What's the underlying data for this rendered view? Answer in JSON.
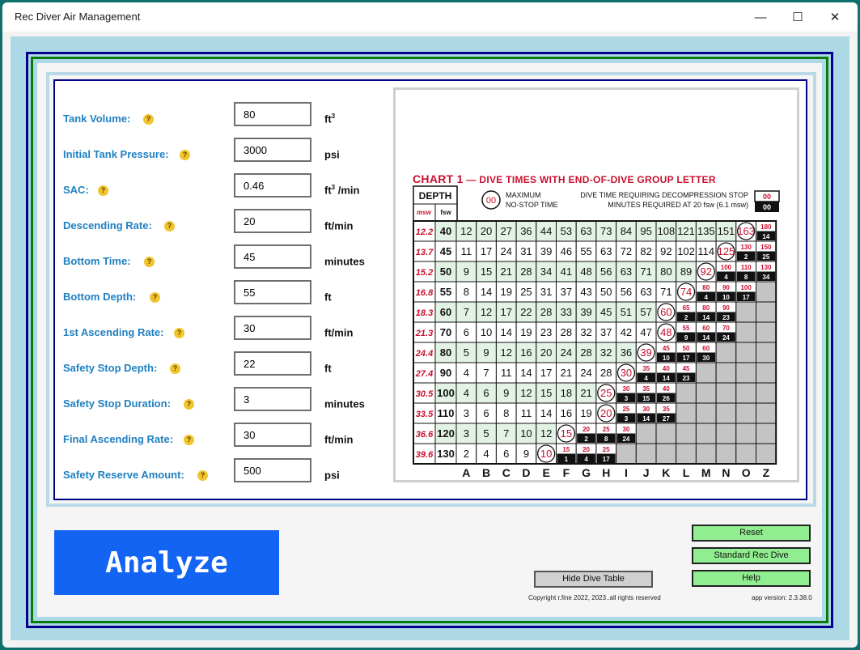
{
  "window": {
    "title": "Rec Diver Air Management",
    "minimize": "—",
    "maximize": "☐",
    "close": "✕"
  },
  "form": {
    "fields": [
      {
        "label": "Tank Volume:",
        "value": "80",
        "unit": "ft",
        "unit_sup": "3",
        "unit_suffix": ""
      },
      {
        "label": "Initial Tank Pressure:",
        "value": "3000",
        "unit": "psi",
        "unit_sup": "",
        "unit_suffix": ""
      },
      {
        "label": "SAC:",
        "value": "0.46",
        "unit": "ft",
        "unit_sup": "3",
        "unit_suffix": " /min"
      },
      {
        "label": "Descending Rate:",
        "value": "20",
        "unit": "ft/min",
        "unit_sup": "",
        "unit_suffix": ""
      },
      {
        "label": "Bottom Time:",
        "value": "45",
        "unit": "minutes",
        "unit_sup": "",
        "unit_suffix": ""
      },
      {
        "label": "Bottom Depth:",
        "value": "55",
        "unit": "ft",
        "unit_sup": "",
        "unit_suffix": ""
      },
      {
        "label": "1st Ascending Rate:",
        "value": "30",
        "unit": "ft/min",
        "unit_sup": "",
        "unit_suffix": ""
      },
      {
        "label": "Safety Stop Depth:",
        "value": "22",
        "unit": "ft",
        "unit_sup": "",
        "unit_suffix": ""
      },
      {
        "label": "Safety Stop Duration:",
        "value": "3",
        "unit": "minutes",
        "unit_sup": "",
        "unit_suffix": ""
      },
      {
        "label": "Final Ascending Rate:",
        "value": "30",
        "unit": "ft/min",
        "unit_sup": "",
        "unit_suffix": ""
      },
      {
        "label": "Safety Reserve Amount:",
        "value": "500",
        "unit": "psi",
        "unit_sup": "",
        "unit_suffix": ""
      }
    ],
    "help_glyph": "?"
  },
  "dive_table": {
    "title": "CHART 1",
    "title_sub": " — DIVE TIMES WITH END-OF-DIVE GROUP LETTER",
    "depth_header": "DEPTH",
    "msw_header": "msw",
    "fsw_header": "fsw",
    "legend_circle": "00",
    "legend_max_1": "MAXIMUM",
    "legend_max_2": "NO-STOP TIME",
    "legend_deco_1": "DIVE TIME REQUIRING DECOMPRESSION STOP",
    "legend_deco_2": "MINUTES REQUIRED AT 20 fsw (6.1 msw)",
    "legend_box_top": "00",
    "legend_box_bottom": "00",
    "colors": {
      "red": "#c8102e",
      "green_cell": "#e2f2e4",
      "gray_cell": "#c4c4c4",
      "black": "#111111"
    },
    "group_letters": [
      "A",
      "B",
      "C",
      "D",
      "E",
      "F",
      "G",
      "H",
      "I",
      "J",
      "K",
      "L",
      "M",
      "N",
      "O",
      "Z"
    ],
    "rows": [
      {
        "msw": "12.2",
        "fsw": "40",
        "times": [
          "12",
          "20",
          "27",
          "36",
          "44",
          "53",
          "63",
          "73",
          "84",
          "95",
          "108",
          "121",
          "135",
          "151"
        ],
        "max": "163",
        "deco": [
          [
            "180",
            "14"
          ]
        ]
      },
      {
        "msw": "13.7",
        "fsw": "45",
        "times": [
          "11",
          "17",
          "24",
          "31",
          "39",
          "46",
          "55",
          "63",
          "72",
          "82",
          "92",
          "102",
          "114"
        ],
        "max": "125",
        "deco": [
          [
            "130",
            "2"
          ],
          [
            "150",
            "25"
          ]
        ]
      },
      {
        "msw": "15.2",
        "fsw": "50",
        "times": [
          "9",
          "15",
          "21",
          "28",
          "34",
          "41",
          "48",
          "56",
          "63",
          "71",
          "80",
          "89"
        ],
        "max": "92",
        "deco": [
          [
            "100",
            "4"
          ],
          [
            "110",
            "8"
          ],
          [
            "130",
            "34"
          ]
        ]
      },
      {
        "msw": "16.8",
        "fsw": "55",
        "times": [
          "8",
          "14",
          "19",
          "25",
          "31",
          "37",
          "43",
          "50",
          "56",
          "63",
          "71"
        ],
        "max": "74",
        "deco": [
          [
            "80",
            "4"
          ],
          [
            "90",
            "10"
          ],
          [
            "100",
            "17"
          ]
        ]
      },
      {
        "msw": "18.3",
        "fsw": "60",
        "times": [
          "7",
          "12",
          "17",
          "22",
          "28",
          "33",
          "39",
          "45",
          "51",
          "57"
        ],
        "max": "60",
        "deco": [
          [
            "65",
            "2"
          ],
          [
            "80",
            "14"
          ],
          [
            "90",
            "23"
          ]
        ]
      },
      {
        "msw": "21.3",
        "fsw": "70",
        "times": [
          "6",
          "10",
          "14",
          "19",
          "23",
          "28",
          "32",
          "37",
          "42",
          "47"
        ],
        "max": "48",
        "deco": [
          [
            "55",
            "9"
          ],
          [
            "60",
            "14"
          ],
          [
            "70",
            "24"
          ]
        ]
      },
      {
        "msw": "24.4",
        "fsw": "80",
        "times": [
          "5",
          "9",
          "12",
          "16",
          "20",
          "24",
          "28",
          "32",
          "36"
        ],
        "max": "39",
        "deco": [
          [
            "45",
            "10"
          ],
          [
            "50",
            "17"
          ],
          [
            "60",
            "30"
          ]
        ]
      },
      {
        "msw": "27.4",
        "fsw": "90",
        "times": [
          "4",
          "7",
          "11",
          "14",
          "17",
          "21",
          "24",
          "28"
        ],
        "max": "30",
        "deco": [
          [
            "35",
            "4"
          ],
          [
            "40",
            "14"
          ],
          [
            "45",
            "23"
          ]
        ]
      },
      {
        "msw": "30.5",
        "fsw": "100",
        "times": [
          "4",
          "6",
          "9",
          "12",
          "15",
          "18",
          "21"
        ],
        "max": "25",
        "deco": [
          [
            "30",
            "3"
          ],
          [
            "35",
            "15"
          ],
          [
            "40",
            "26"
          ]
        ]
      },
      {
        "msw": "33.5",
        "fsw": "110",
        "times": [
          "3",
          "6",
          "8",
          "11",
          "14",
          "16",
          "19"
        ],
        "max": "20",
        "deco": [
          [
            "25",
            "3"
          ],
          [
            "30",
            "14"
          ],
          [
            "35",
            "27"
          ]
        ]
      },
      {
        "msw": "36.6",
        "fsw": "120",
        "times": [
          "3",
          "5",
          "7",
          "10",
          "12"
        ],
        "max": "15",
        "deco": [
          [
            "20",
            "2"
          ],
          [
            "25",
            "8"
          ],
          [
            "30",
            "24"
          ]
        ]
      },
      {
        "msw": "39.6",
        "fsw": "130",
        "times": [
          "2",
          "4",
          "6",
          "9"
        ],
        "max": "10",
        "deco": [
          [
            "15",
            "1"
          ],
          [
            "20",
            "4"
          ],
          [
            "25",
            "17"
          ]
        ]
      }
    ]
  },
  "buttons": {
    "analyze": "Analyze",
    "reset": "Reset",
    "standard": "Standard Rec Dive",
    "help": "Help",
    "hide_table": "Hide Dive Table"
  },
  "footer": {
    "copyright": "Copyright r.fine 2022, 2023..all rights reserved",
    "version": "app version: 2.3.38.0"
  }
}
